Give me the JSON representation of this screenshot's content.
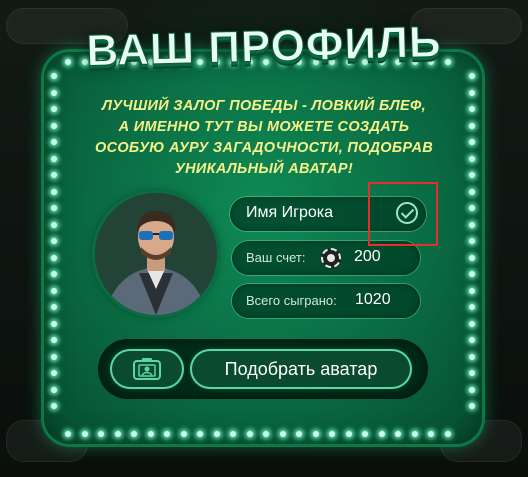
{
  "dialog": {
    "title": "ВАШ ПРОФИЛЬ",
    "description_lines": [
      "ЛУЧШИЙ ЗАЛОГ ПОБЕДЫ - ЛОВКИЙ БЛЕФ,",
      "А ИМЕННО ТУТ ВЫ МОЖЕТЕ СОЗДАТЬ",
      "ОСОБУЮ АУРУ ЗАГАДОЧНОСТИ, ПОДОБРАВ",
      "УНИКАЛЬНЫЙ АВАТАР!"
    ]
  },
  "profile": {
    "player_name": "Имя Игрока",
    "score_label": "Ваш счет:",
    "score_value": "200",
    "games_label": "Всего сыграно:",
    "games_value": "1020"
  },
  "actions": {
    "pick_avatar_label": "Подобрать аватар",
    "camera_icon": "photo-id-icon",
    "confirm_icon": "check-circle-icon"
  },
  "colors": {
    "panel_green": "#0a6b42",
    "bulb": "#cafff0",
    "description_yellow": "#f6f08a",
    "highlight_red": "#e03030"
  }
}
